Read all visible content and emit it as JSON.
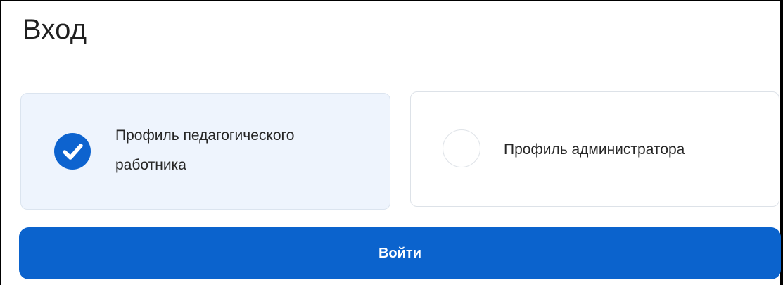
{
  "page": {
    "title": "Вход"
  },
  "profiles": [
    {
      "label": "Профиль педагогического работника",
      "selected": true
    },
    {
      "label": "Профиль администратора",
      "selected": false
    }
  ],
  "actions": {
    "login_label": "Войти"
  },
  "colors": {
    "accent": "#0b63cd",
    "selected_card_bg": "#eef4fd",
    "text": "#262626"
  }
}
